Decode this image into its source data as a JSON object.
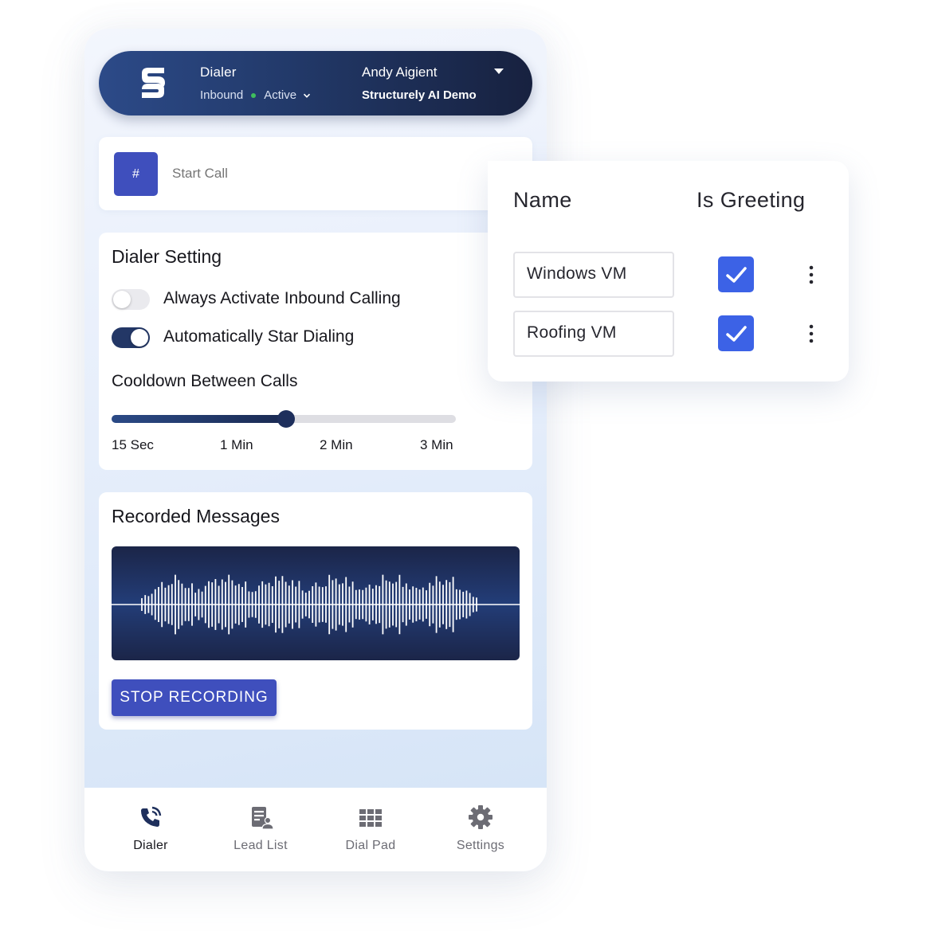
{
  "header": {
    "title": "Dialer",
    "mode": "Inbound",
    "status": "Active",
    "user_name": "Andy Aigient",
    "company": "Structurely AI Demo"
  },
  "start_call": {
    "button_label": "#",
    "placeholder": "Start Call"
  },
  "dialer_setting": {
    "title": "Dialer Setting",
    "toggles": [
      {
        "label": "Always Activate Inbound Calling",
        "on": false
      },
      {
        "label": "Automatically Star Dialing",
        "on": true
      }
    ],
    "cooldown": {
      "title": "Cooldown Between Calls",
      "ticks": [
        "15 Sec",
        "1 Min",
        "2 Min",
        "3 Min"
      ],
      "value_fraction": 0.507
    }
  },
  "recorded_messages": {
    "title": "Recorded Messages",
    "stop_label": "STOP RECORDING"
  },
  "greetings": {
    "col_name": "Name",
    "col_greeting": "Is Greeting",
    "rows": [
      {
        "name": "Windows VM",
        "is_greeting": true
      },
      {
        "name": "Roofing VM",
        "is_greeting": true
      }
    ]
  },
  "nav": {
    "items": [
      {
        "label": "Dialer",
        "icon": "phone-icon",
        "active": true
      },
      {
        "label": "Lead List",
        "icon": "lead-list-icon",
        "active": false
      },
      {
        "label": "Dial Pad",
        "icon": "dial-pad-icon",
        "active": false
      },
      {
        "label": "Settings",
        "icon": "gear-icon",
        "active": false
      }
    ]
  },
  "colors": {
    "accent": "#3f4fbd",
    "navy": "#1e2f5c",
    "checkbox": "#3c62e6",
    "active_dot": "#3fbf5d"
  }
}
